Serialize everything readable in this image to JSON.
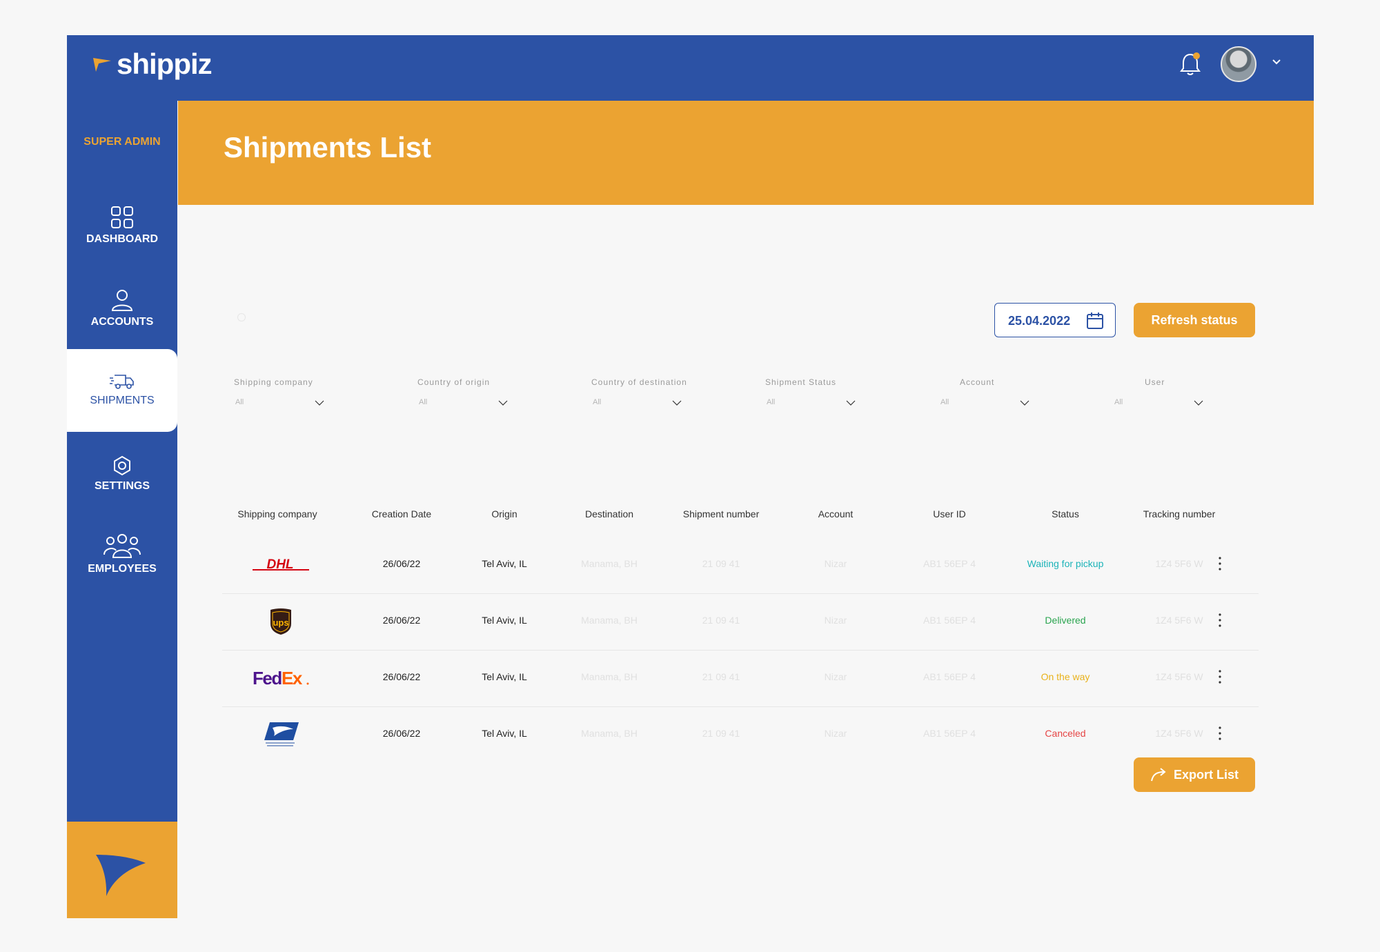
{
  "app": {
    "brand": "shippiz",
    "role_label": "SUPER ADMIN",
    "colors": {
      "primary": "#2c52a5",
      "accent": "#eba332"
    }
  },
  "sidebar": {
    "items": [
      {
        "label": "DASHBOARD",
        "icon": "grid-icon"
      },
      {
        "label": "ACCOUNTS",
        "icon": "user-icon"
      },
      {
        "label": "SHIPMENTS",
        "icon": "truck-icon",
        "active": true
      },
      {
        "label": "SETTINGS",
        "icon": "gear-icon"
      },
      {
        "label": "EMPLOYEES",
        "icon": "people-icon"
      }
    ]
  },
  "header": {
    "title": "Shipments List"
  },
  "toolbar": {
    "date": "25.04.2022",
    "refresh_label": "Refresh status",
    "export_label": "Export List"
  },
  "filters": [
    {
      "label": "Shipping company",
      "value": "All"
    },
    {
      "label": "Country of origin",
      "value": "All"
    },
    {
      "label": "Country of destination",
      "value": "All"
    },
    {
      "label": "Shipment Status",
      "value": "All"
    },
    {
      "label": "Account",
      "value": "All"
    },
    {
      "label": "User",
      "value": "All"
    }
  ],
  "table": {
    "columns": [
      "Shipping company",
      "Creation Date",
      "Origin",
      "Destination",
      "Shipment number",
      "Account",
      "User ID",
      "Status",
      "Tracking number"
    ],
    "rows": [
      {
        "carrier": "DHL",
        "date": "26/06/22",
        "origin": "Tel Aviv, IL",
        "destination": "Manama, BH",
        "number": "21 09 41",
        "account": "Nizar",
        "user_id": "AB1 56EP 4",
        "status": "Waiting for pickup",
        "status_color": "#1bb3b8",
        "tracking": "1Z4 5F6 W"
      },
      {
        "carrier": "UPS",
        "date": "26/06/22",
        "origin": "Tel Aviv, IL",
        "destination": "Manama, BH",
        "number": "21 09 41",
        "account": "Nizar",
        "user_id": "AB1 56EP 4",
        "status": "Delivered",
        "status_color": "#2aa44f",
        "tracking": "1Z4 5F6 W"
      },
      {
        "carrier": "FedEx",
        "date": "26/06/22",
        "origin": "Tel Aviv, IL",
        "destination": "Manama, BH",
        "number": "21 09 41",
        "account": "Nizar",
        "user_id": "AB1 56EP 4",
        "status": "On the way",
        "status_color": "#e9b21a",
        "tracking": "1Z4 5F6 W"
      },
      {
        "carrier": "USPS",
        "date": "26/06/22",
        "origin": "Tel Aviv, IL",
        "destination": "Manama, BH",
        "number": "21 09 41",
        "account": "Nizar",
        "user_id": "AB1 56EP 4",
        "status": "Canceled",
        "status_color": "#e64545",
        "tracking": "1Z4 5F6 W"
      }
    ]
  }
}
